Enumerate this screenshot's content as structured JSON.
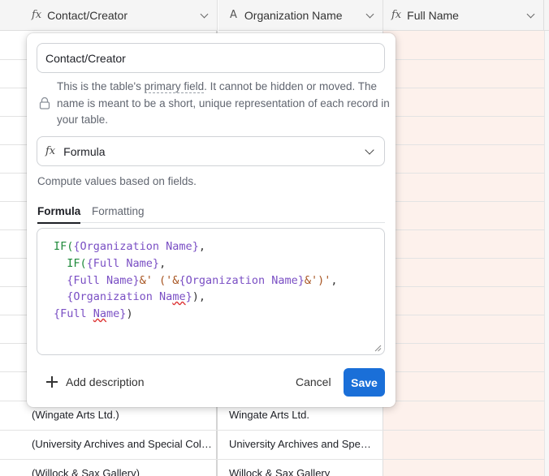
{
  "grid": {
    "columns": [
      {
        "icon": "formula-icon",
        "glyph": "fx",
        "label": "Contact/Creator"
      },
      {
        "icon": "text-field-icon",
        "glyph": "A",
        "label": "Organization Name"
      },
      {
        "icon": "formula-icon",
        "glyph": "fx",
        "label": "Full Name"
      }
    ],
    "rows": [
      {
        "contact": "(Wingate Arts Ltd.)",
        "organization": "Wingate Arts Ltd."
      },
      {
        "contact": "(University Archives and Special Collections)",
        "organization": "University Archives and Special Collections"
      },
      {
        "contact": "(Willock & Sax Gallery)",
        "organization": "Willock & Sax Gallery"
      }
    ]
  },
  "field_editor": {
    "field_name": "Contact/Creator",
    "primary_note": {
      "part1": "This is the table's ",
      "link": "primary field",
      "part2": ". It cannot be hidden or moved. The name is meant to be a short, unique representation of each record in your table."
    },
    "field_type": {
      "glyph": "fx",
      "label": "Formula"
    },
    "type_description": "Compute values based on fields.",
    "tabs": [
      "Formula",
      "Formatting"
    ],
    "active_tab": "Formula",
    "formula": {
      "l1_fn": "IF(",
      "l1_ref": "{Organization Name}",
      "l1_end": ",",
      "l2_fn": "IF(",
      "l2_ref": "{Full Name}",
      "l2_end": ",",
      "l3_ref1": "{Full Name}",
      "l3_str1": "&' ('&",
      "l3_ref2": "{Organization Name}",
      "l3_str2": "&')'",
      "l3_end": ",",
      "l4_ref_a": "{Organization Na",
      "l4_ref_b": "me",
      "l4_ref_c": "}",
      "l4_end": "),",
      "l5_ref_a": "{Full ",
      "l5_ref_b": "Na",
      "l5_ref_c": "me}",
      "l5_end": ")"
    },
    "add_description": "Add description",
    "cancel": "Cancel",
    "save": "Save"
  },
  "colors": {
    "save_button": "#1a6fd8",
    "field_ref": "#7a4fc4",
    "function": "#1f8a3b",
    "highlight_column": "#fdf1ec"
  }
}
